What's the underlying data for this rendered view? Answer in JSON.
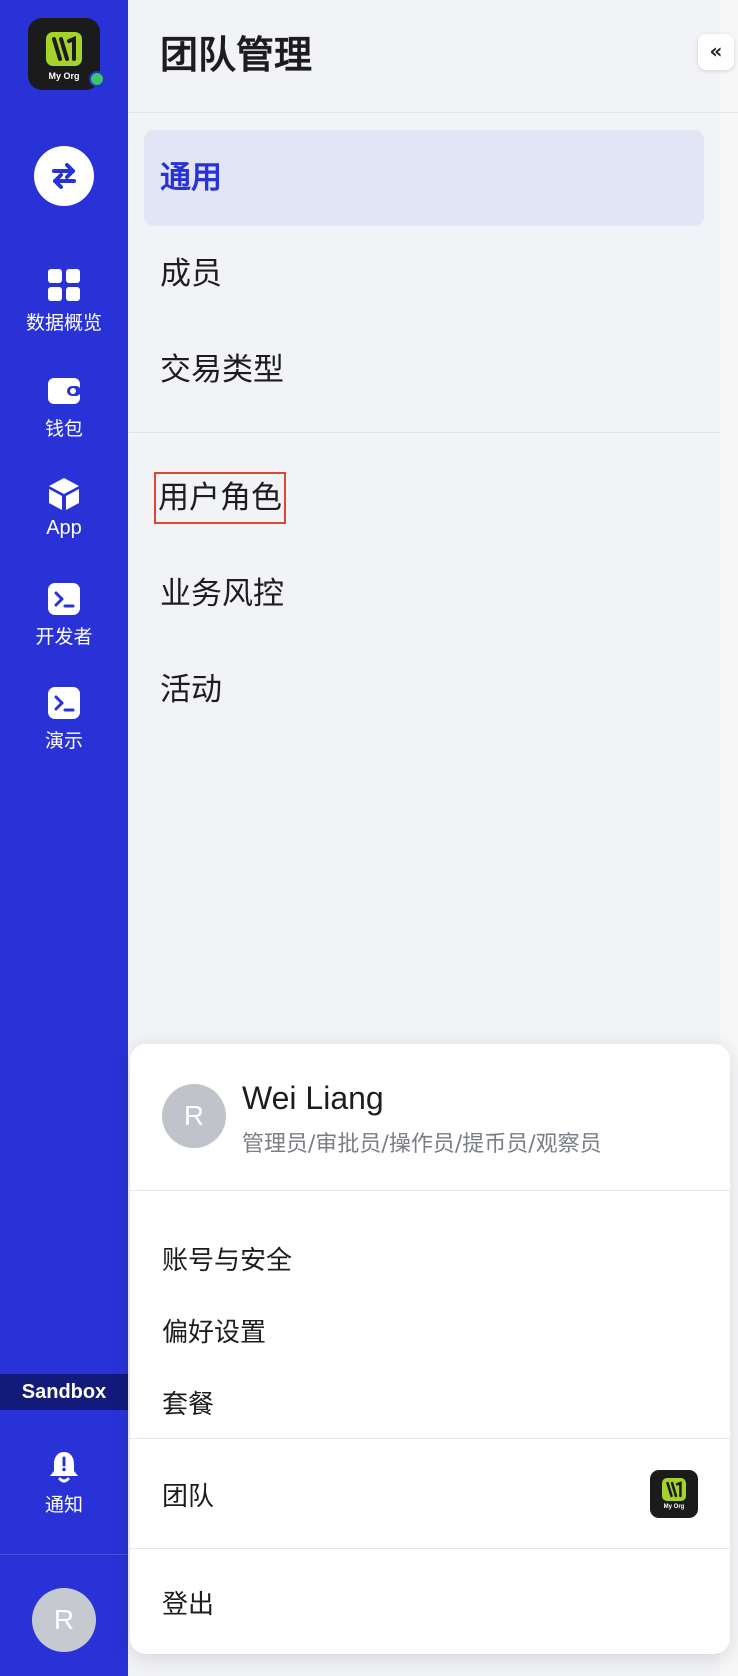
{
  "sidebar": {
    "org_logo_text": "My Org",
    "org_status": "online",
    "switch_icon": "swap-arrows-icon",
    "nav": [
      {
        "label": "数据概览",
        "icon": "dashboard-grid-icon"
      },
      {
        "label": "钱包",
        "icon": "wallet-icon"
      },
      {
        "label": "App",
        "icon": "cube-icon"
      },
      {
        "label": "开发者",
        "icon": "terminal-icon"
      },
      {
        "label": "演示",
        "icon": "terminal-icon"
      }
    ],
    "environment_badge": "Sandbox",
    "notifications_label": "通知",
    "notifications_icon": "bell-icon",
    "user_initial": "R"
  },
  "panel": {
    "title": "团队管理",
    "collapse_icon": "double-chevron-left-icon",
    "menu_group_1": [
      "通用",
      "成员",
      "交易类型"
    ],
    "menu_group_2": [
      "用户角色",
      "业务风控",
      "活动"
    ],
    "active_item": "通用",
    "highlighted_item": "用户角色"
  },
  "popup": {
    "avatar_initial": "R",
    "user_name": "Wei Liang",
    "roles": "管理员/审批员/操作员/提币员/观察员",
    "items": [
      "账号与安全",
      "偏好设置",
      "套餐"
    ],
    "team_label": "团队",
    "team_logo_text": "My Org",
    "logout_label": "登出"
  },
  "colors": {
    "sidebar_bg": "#2832d6",
    "accent": "#2832d6",
    "active_bg": "#e2e5f6",
    "highlight_border": "#d94a35",
    "brand_green": "#a6d22c",
    "status_green": "#3dc465"
  }
}
